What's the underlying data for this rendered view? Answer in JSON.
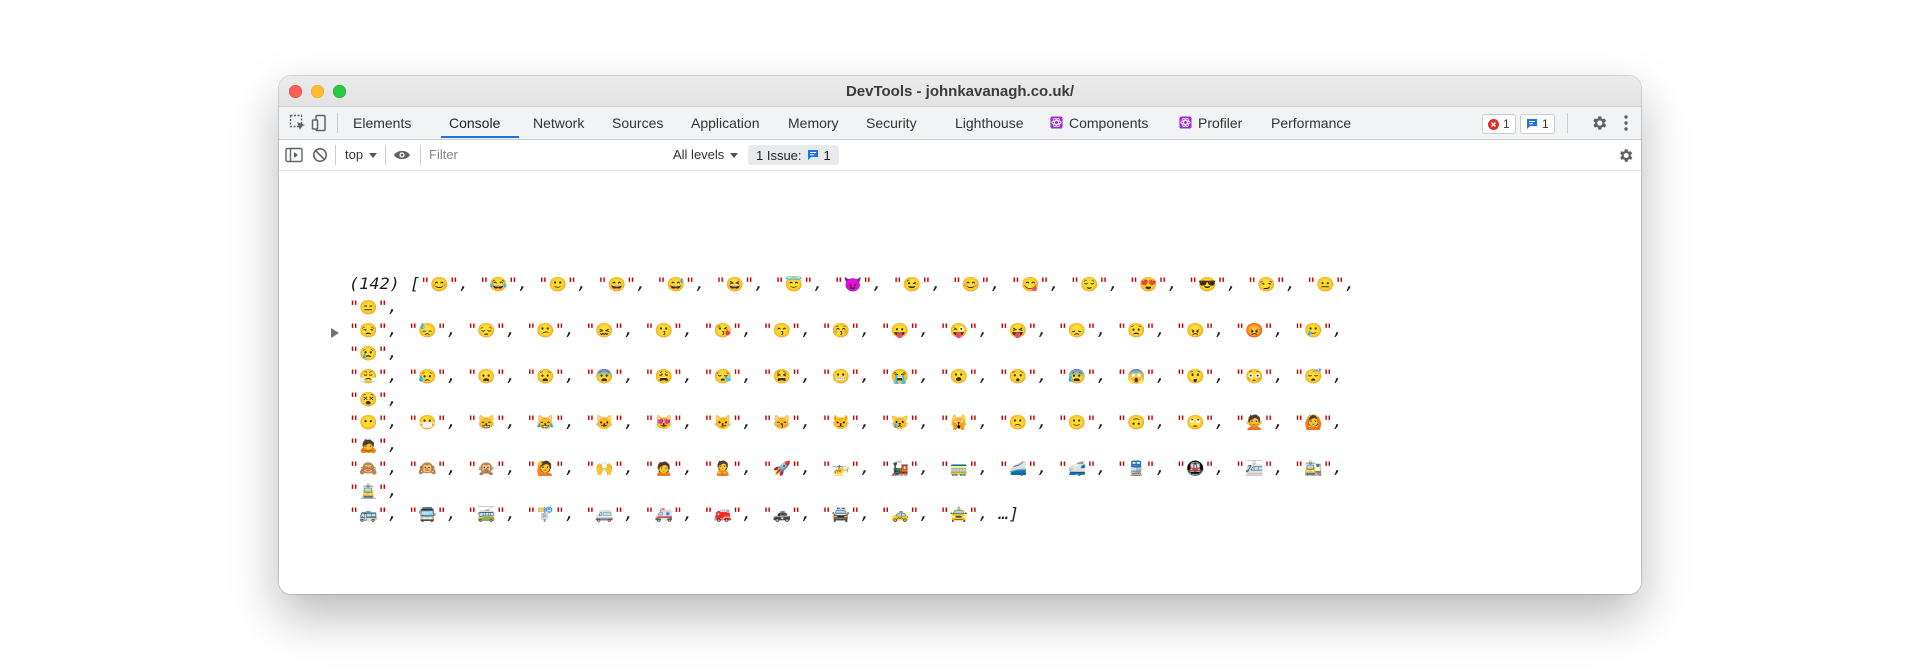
{
  "window": {
    "title": "DevTools - johnkavanagh.co.uk/"
  },
  "tabs": [
    {
      "label": "Elements"
    },
    {
      "label": "Console"
    },
    {
      "label": "Network"
    },
    {
      "label": "Sources"
    },
    {
      "label": "Application"
    },
    {
      "label": "Memory"
    },
    {
      "label": "Security"
    },
    {
      "label": "Lighthouse"
    },
    {
      "label": "Components"
    },
    {
      "label": "Profiler"
    },
    {
      "label": "Performance"
    }
  ],
  "active_tab": "Console",
  "status": {
    "errors": "1",
    "messages": "1"
  },
  "filterbar": {
    "context": "top",
    "filter_placeholder": "Filter",
    "levels": "All levels",
    "issues_label": "1 Issue:",
    "issues_count": "1"
  },
  "console": {
    "count": "(142)",
    "lines": [
      "😊 😂 🙂 😄 😅 😆 😇 😈 😉 😊 😋 😌 😍 😎 😏 😐 😑",
      "😒 😓 😔 😕 😖 😗 😘 😙 😚 😛 😜 😝 😞 😟 😠 😡 🥲 😢",
      "😤 😥 😦 😧 😨 😩 😪 😫 😬 😭 😮 😯 😰 😱 😲 😳 😴 😵",
      "😶 😷 😸 😹 😺 😻 😼 😽 😾 😿 🙀 🙁 🙂 🙃 🙄 🙅 🙆 🙇",
      "🙈 🙉 🙊 🙋 🙌 🙍 🙎 🚀 🚁 🚂 🚃 🚄 🚅 🚆 🚇 🚈 🚉 🚊",
      "🚌 🚍 🚎 🚏 🚐 🚑 🚒 🚓 🚔 🚕 🚖"
    ],
    "ellipsis": "…"
  },
  "icons": {
    "inspect": "inspect-icon",
    "device": "device-toolbar-icon",
    "settings": "gear-icon",
    "more": "kebab-menu-icon",
    "sidebar": "sidebar-toggle-icon",
    "clear": "clear-console-icon",
    "eye": "eye-icon"
  },
  "colors": {
    "accent": "#1a73e8",
    "error": "#d93025",
    "string": "#c80000"
  }
}
